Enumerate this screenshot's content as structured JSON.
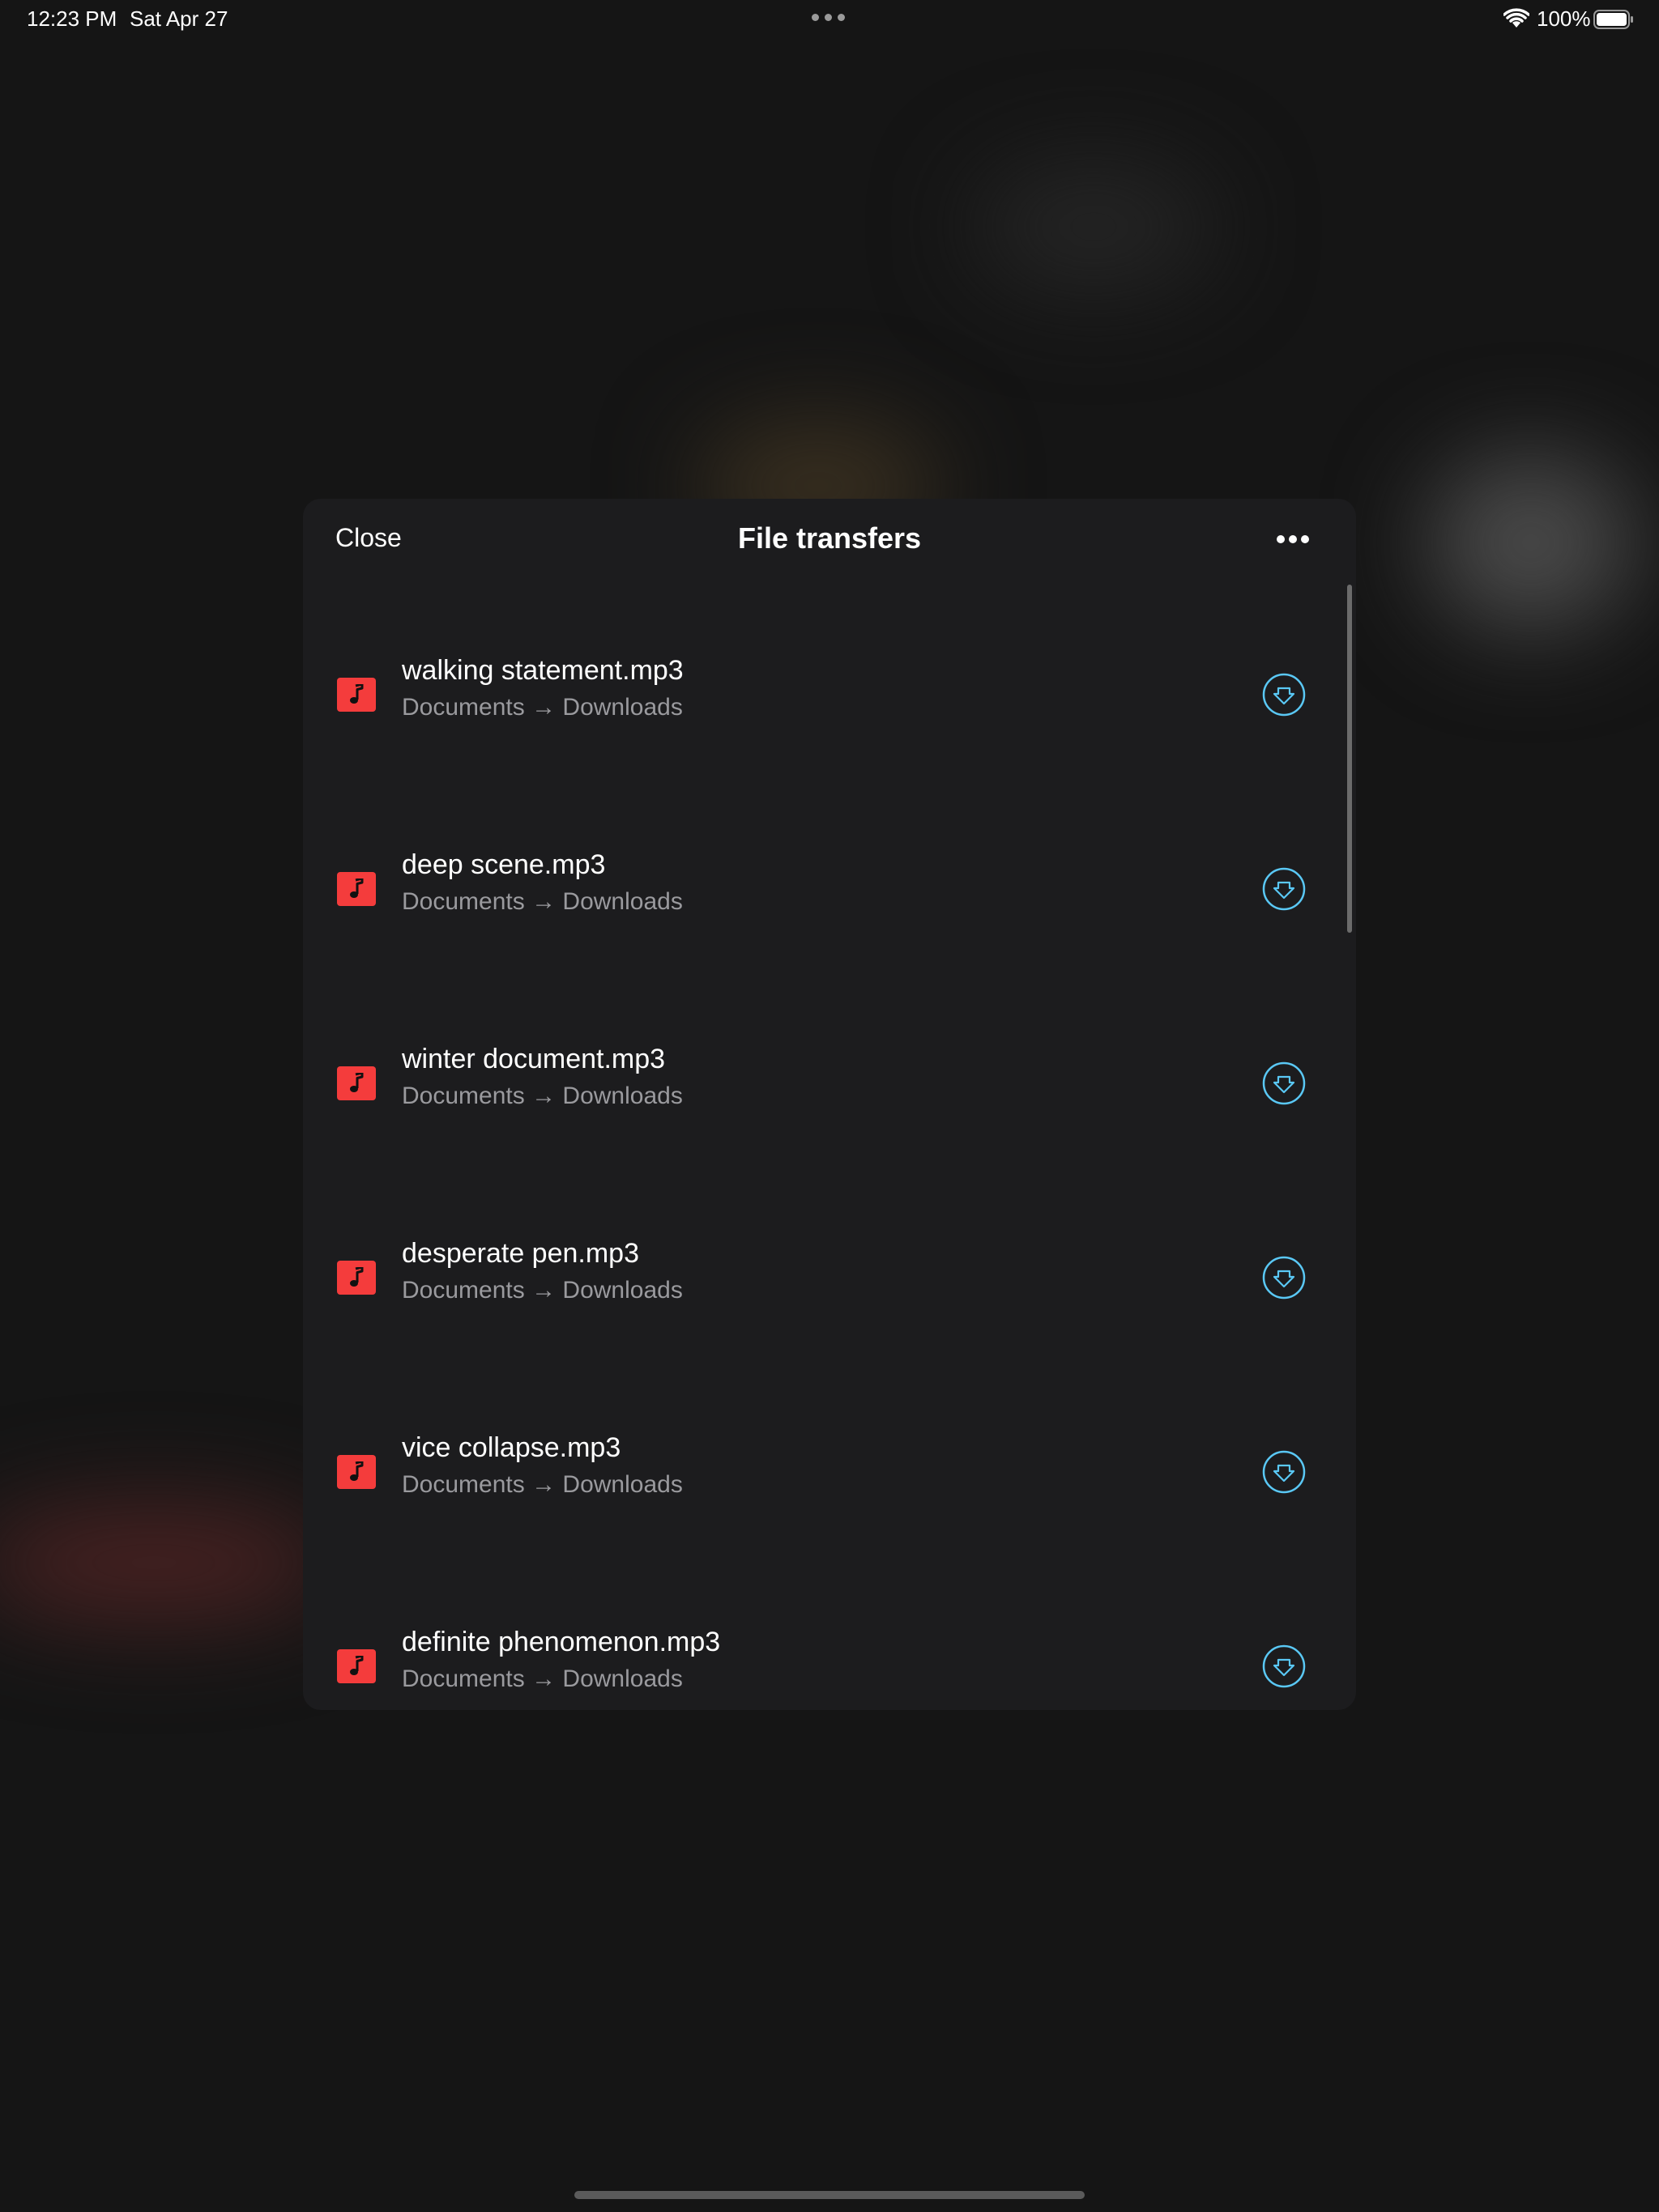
{
  "status_bar": {
    "time": "12:23 PM",
    "date": "Sat Apr 27",
    "battery": "100%"
  },
  "sheet": {
    "close_label": "Close",
    "title": "File transfers"
  },
  "transfers": [
    {
      "name": "walking statement.mp3",
      "path": "Documents → Downloads",
      "icon": "music-note-icon",
      "action_icon": "download-icon"
    },
    {
      "name": "deep scene.mp3",
      "path": "Documents → Downloads",
      "icon": "music-note-icon",
      "action_icon": "download-icon"
    },
    {
      "name": "winter document.mp3",
      "path": "Documents → Downloads",
      "icon": "music-note-icon",
      "action_icon": "download-icon"
    },
    {
      "name": "desperate pen.mp3",
      "path": "Documents → Downloads",
      "icon": "music-note-icon",
      "action_icon": "download-icon"
    },
    {
      "name": "vice collapse.mp3",
      "path": "Documents → Downloads",
      "icon": "music-note-icon",
      "action_icon": "download-icon"
    },
    {
      "name": "definite phenomenon.mp3",
      "path": "Documents → Downloads",
      "icon": "music-note-icon",
      "action_icon": "download-icon"
    }
  ],
  "colors": {
    "file_icon": "#f43c3c",
    "download_accent": "#5ac8f5",
    "sheet_background": "#1c1c1e"
  }
}
